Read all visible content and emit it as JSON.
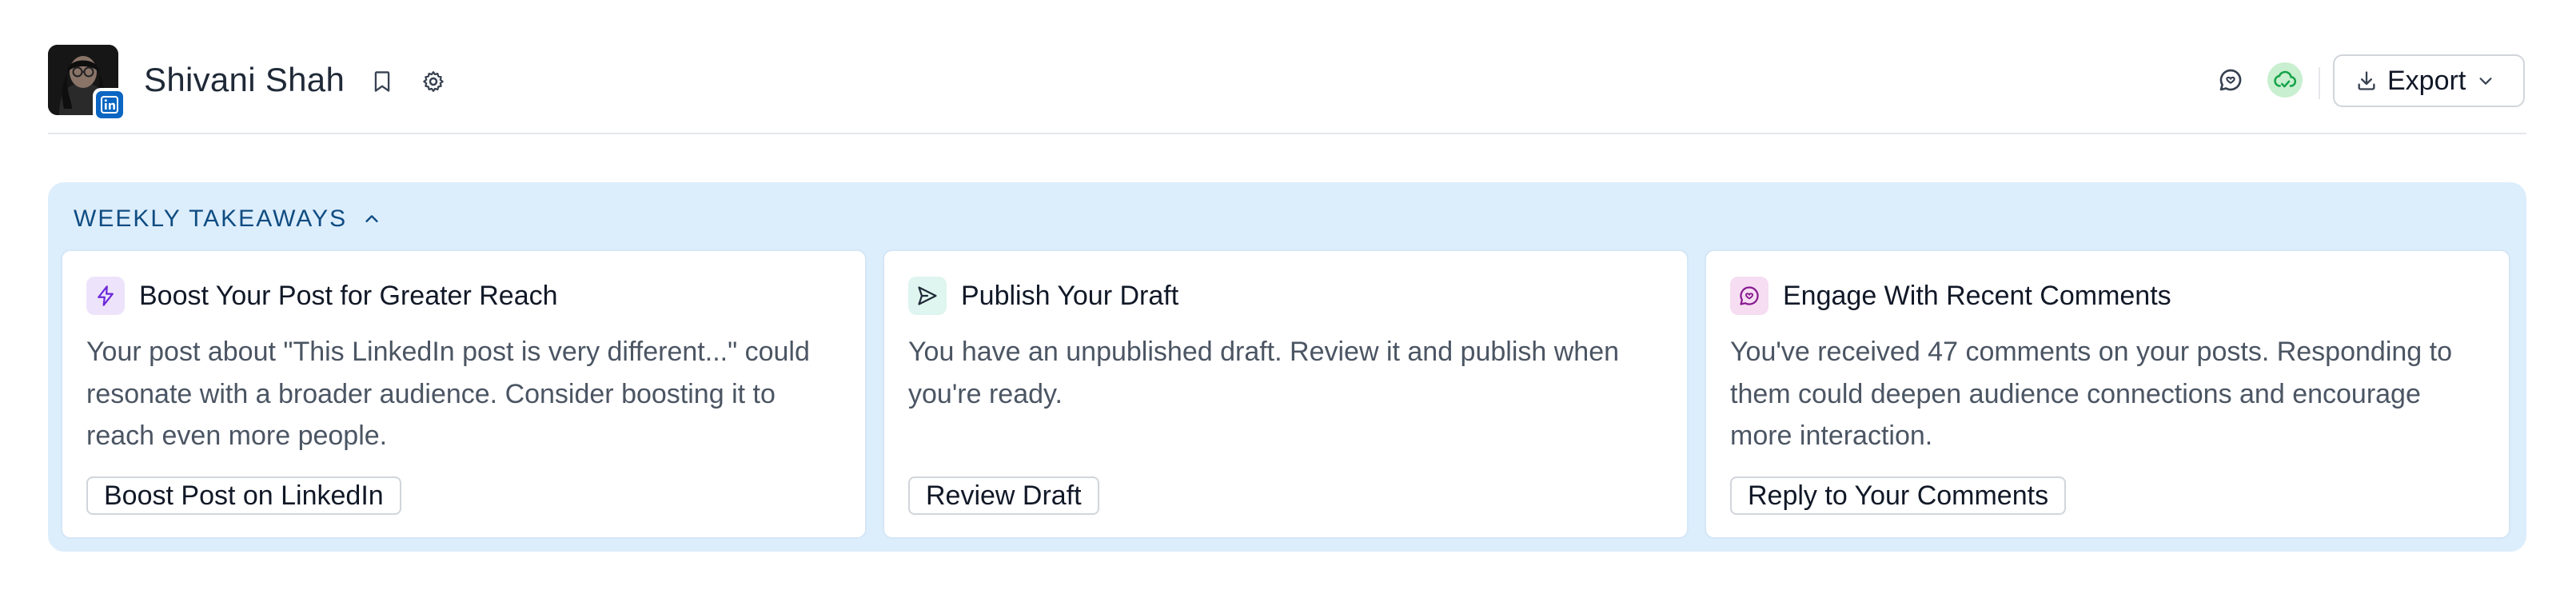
{
  "header": {
    "profile_name": "Shivani Shah",
    "avatar_badge": "linkedin-icon",
    "actions": {
      "bookmark_icon": "bookmark-icon",
      "settings_icon": "gear-icon",
      "comment_icon": "comment-icon",
      "sync_icon": "cloud-sync-icon",
      "export_label": "Export"
    }
  },
  "takeaways": {
    "title": "WEEKLY TAKEAWAYS",
    "expanded": true,
    "cards": [
      {
        "icon": "lightning-icon",
        "icon_color": "#7c3aed",
        "title": "Boost Your Post for Greater Reach",
        "body": "Your post about \"This LinkedIn post is very different...\" could resonate with a broader audience. Consider boosting it to reach even more people.",
        "action_label": "Boost Post on LinkedIn"
      },
      {
        "icon": "send-icon",
        "icon_color": "#1f2937",
        "title": "Publish Your Draft",
        "body": "You have an unpublished draft. Review it and publish when you're ready.",
        "action_label": "Review Draft"
      },
      {
        "icon": "comment-icon",
        "icon_color": "#86198f",
        "title": "Engage With Recent Comments",
        "body": "You've received 47 comments on your posts. Responding to them could deepen audience connections and encourage more interaction.",
        "action_label": "Reply to Your Comments"
      }
    ]
  },
  "colors": {
    "panel_background": "#dcedfc",
    "panel_title": "#0f4c81",
    "linkedin_blue": "#0a66c2",
    "sync_green": "#c8efcf"
  }
}
